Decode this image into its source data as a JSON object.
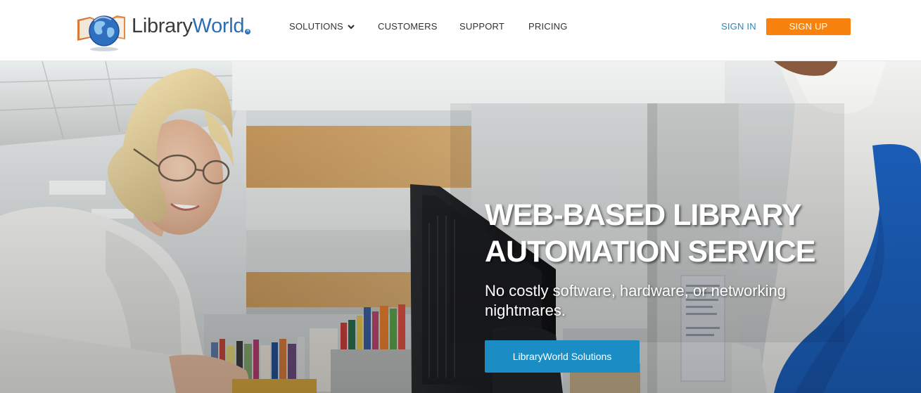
{
  "brand": {
    "name_part1": "Library",
    "name_part2": "World",
    "registered_mark": "R",
    "logo_icon": "globe-book-icon"
  },
  "nav": {
    "items": [
      {
        "label": "SOLUTIONS",
        "icon": "chevron-down-icon"
      },
      {
        "label": "CUSTOMERS"
      },
      {
        "label": "SUPPORT"
      },
      {
        "label": "PRICING"
      }
    ]
  },
  "auth": {
    "sign_in": "SIGN IN",
    "sign_up": "SIGN UP"
  },
  "hero": {
    "headline_line1": "WEB-BASED LIBRARY",
    "headline_line2": "AUTOMATION SERVICE",
    "subhead": "No costly software, hardware, or networking nightmares.",
    "cta_label": "LibraryWorld Solutions"
  },
  "colors": {
    "accent_orange": "#f7820e",
    "link_blue": "#1f8bc4",
    "cta_blue": "#1a8ec4",
    "brand_blue": "#2a6fb5"
  }
}
